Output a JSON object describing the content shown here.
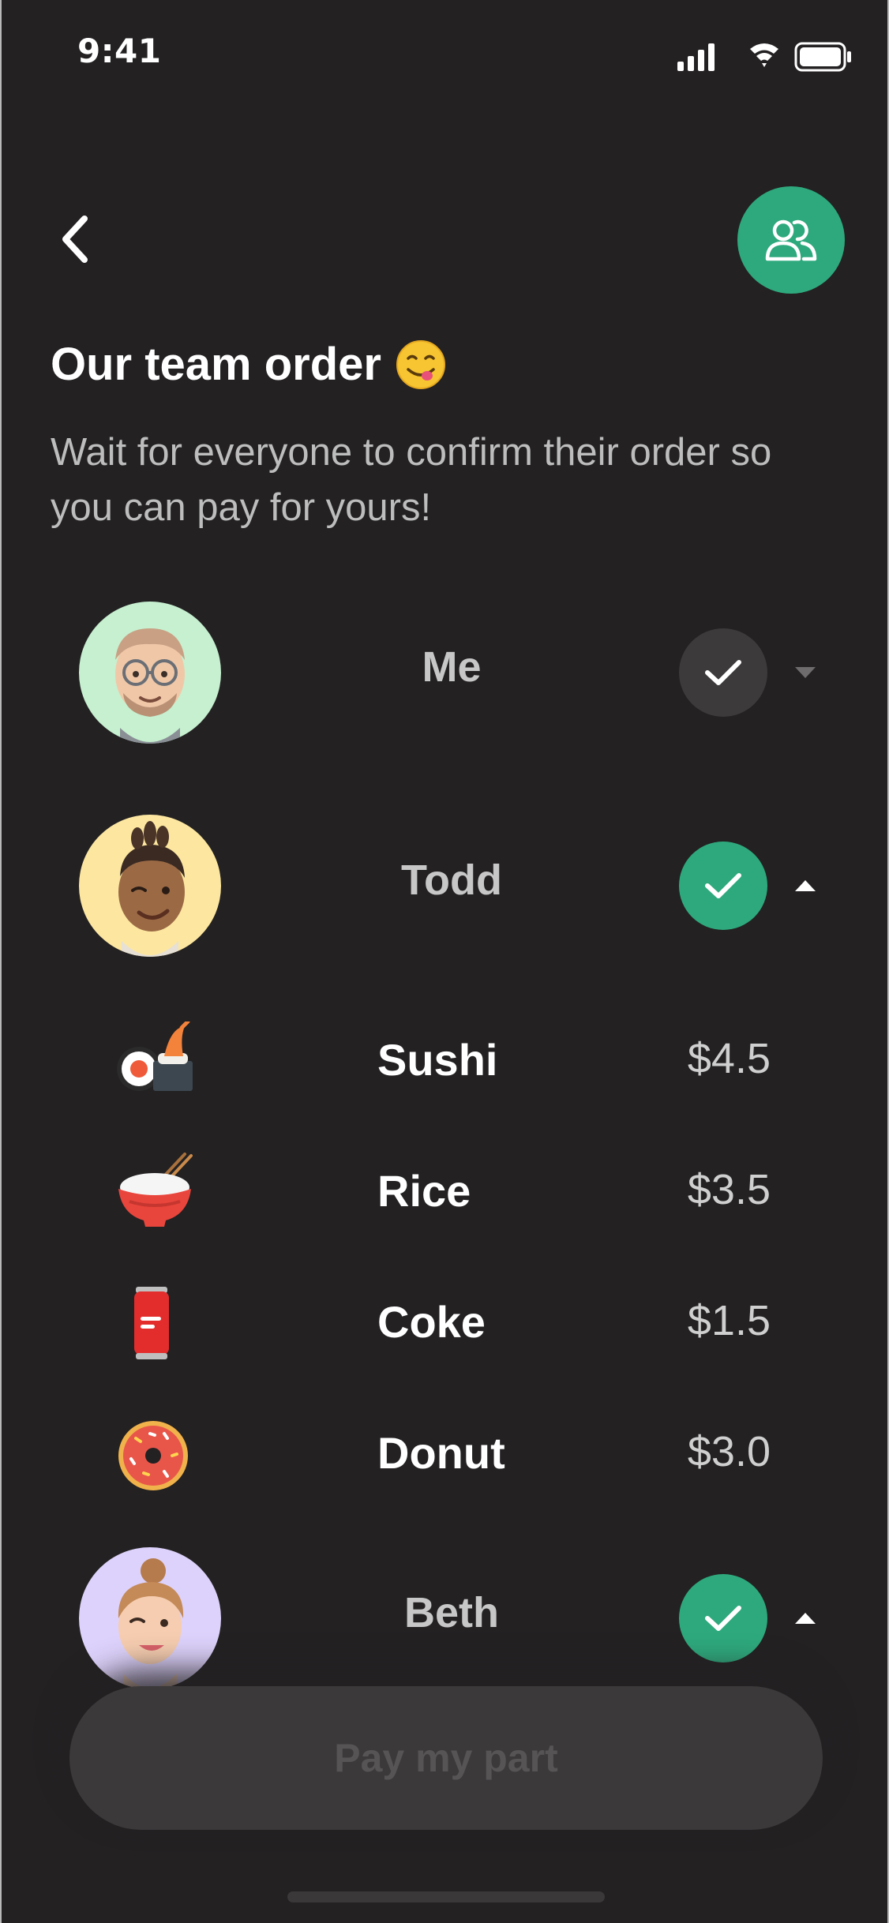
{
  "status_bar": {
    "time": "9:41",
    "icons": [
      "cellular-signal-icon",
      "wifi-icon",
      "battery-icon"
    ]
  },
  "header": {
    "back_icon": "chevron-left-icon",
    "team_icon": "people-icon"
  },
  "title": {
    "text": "Our team order",
    "emoji": "face-savoring-food-emoji"
  },
  "subtitle": "Wait for everyone to confirm their order so you can pay for yours!",
  "members": [
    {
      "name": "Me",
      "status": "pending",
      "expanded": false,
      "avatar_color": "#c6f0d0"
    },
    {
      "name": "Todd",
      "status": "confirmed",
      "expanded": true,
      "avatar_color": "#fde7a0"
    },
    {
      "name": "Beth",
      "status": "confirmed",
      "expanded": true,
      "avatar_color": "#ddd2fb"
    }
  ],
  "items": [
    {
      "name": "Sushi",
      "price": "$4.5",
      "icon": "sushi-icon"
    },
    {
      "name": "Rice",
      "price": "$3.5",
      "icon": "rice-bowl-icon"
    },
    {
      "name": "Coke",
      "price": "$1.5",
      "icon": "soda-can-icon"
    },
    {
      "name": "Donut",
      "price": "$3.0",
      "icon": "donut-icon"
    }
  ],
  "pay_button": {
    "label": "Pay my part",
    "enabled": false
  },
  "colors": {
    "background": "#232122",
    "accent": "#2ea97d",
    "pending_badge": "#3c3a3b"
  }
}
